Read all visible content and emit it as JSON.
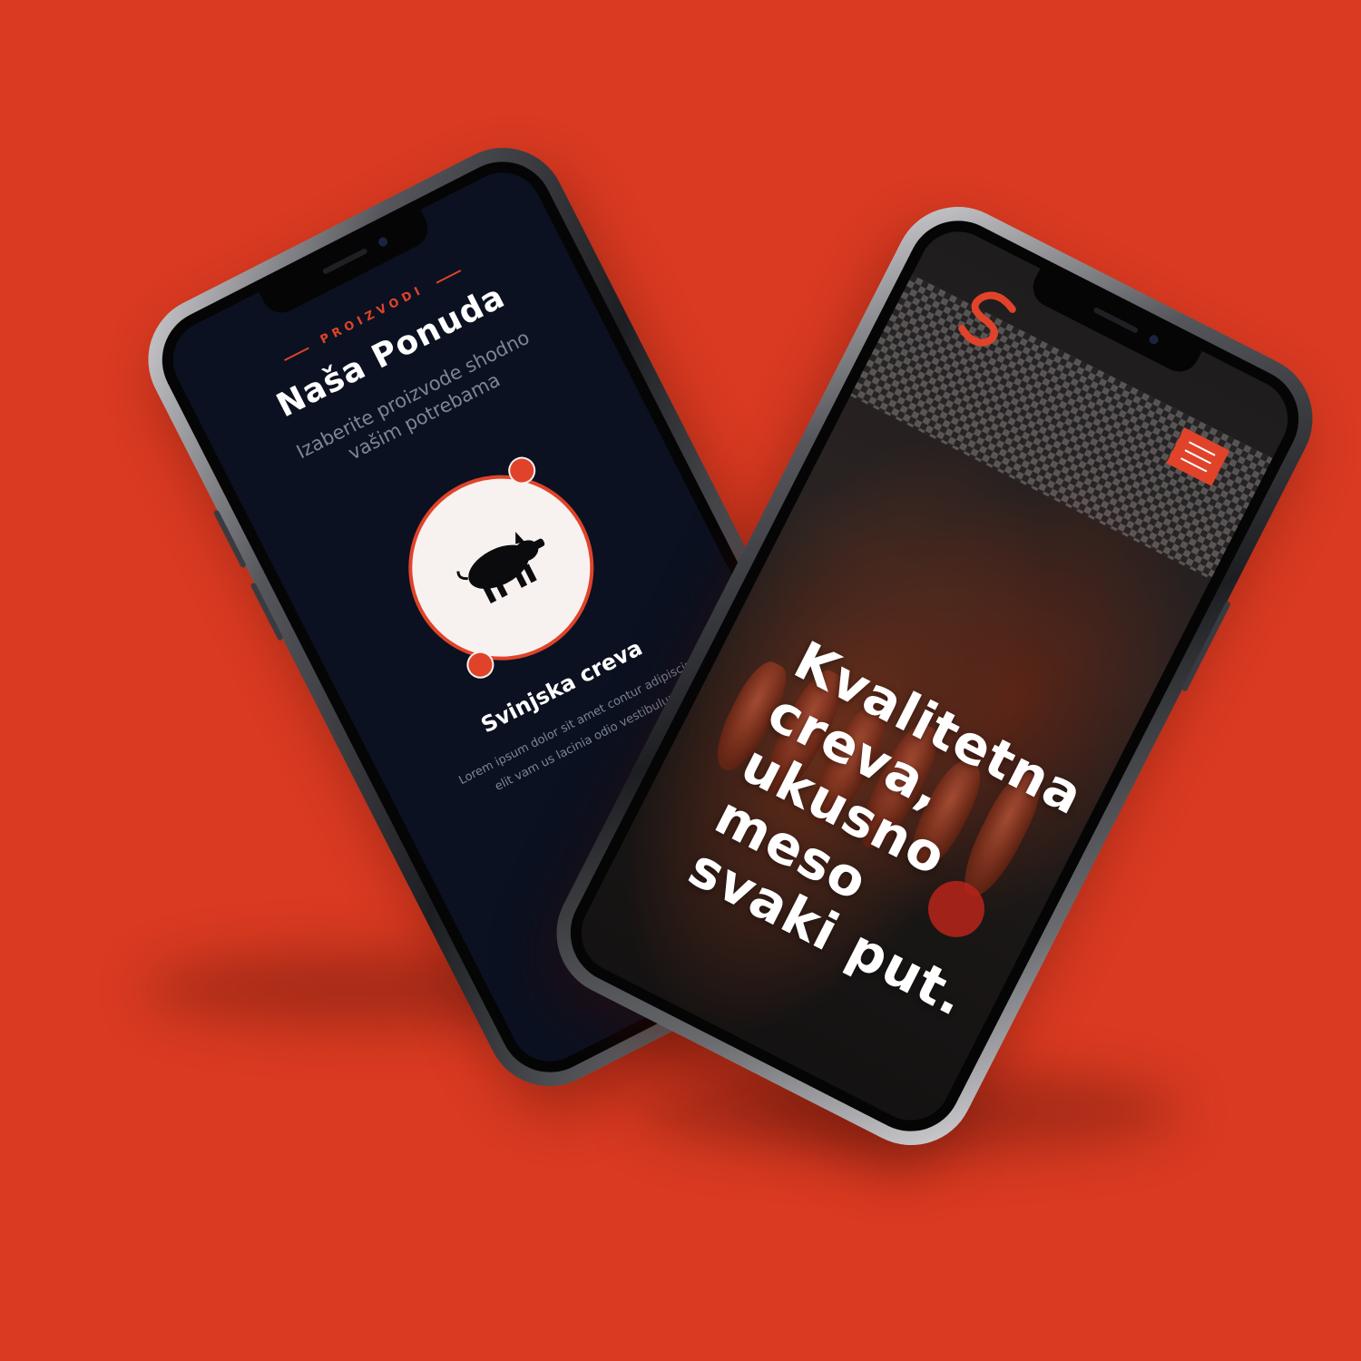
{
  "colors": {
    "background": "#d93a21",
    "accent": "#e0432a",
    "screen_dark": "#0b1120",
    "badge_fill": "#f7f2f0"
  },
  "left_screen": {
    "eyebrow": "PROIZVODI",
    "title": "Naša Ponuda",
    "subtitle": "Izaberite proizvode shodno vašim potrebama",
    "products": [
      {
        "icon": "pig-icon",
        "title": "Svinjska creva",
        "description": "Lorem ipsum dolor sit amet contur adipiscing elit vam us lacinia odio vestibulum."
      },
      {
        "icon": "sheep-icon"
      }
    ]
  },
  "right_screen": {
    "menu_icon": "hamburger-icon",
    "hero_lines": [
      "Kvalitetna",
      "creva,",
      "ukusno meso",
      "svaki put."
    ]
  }
}
